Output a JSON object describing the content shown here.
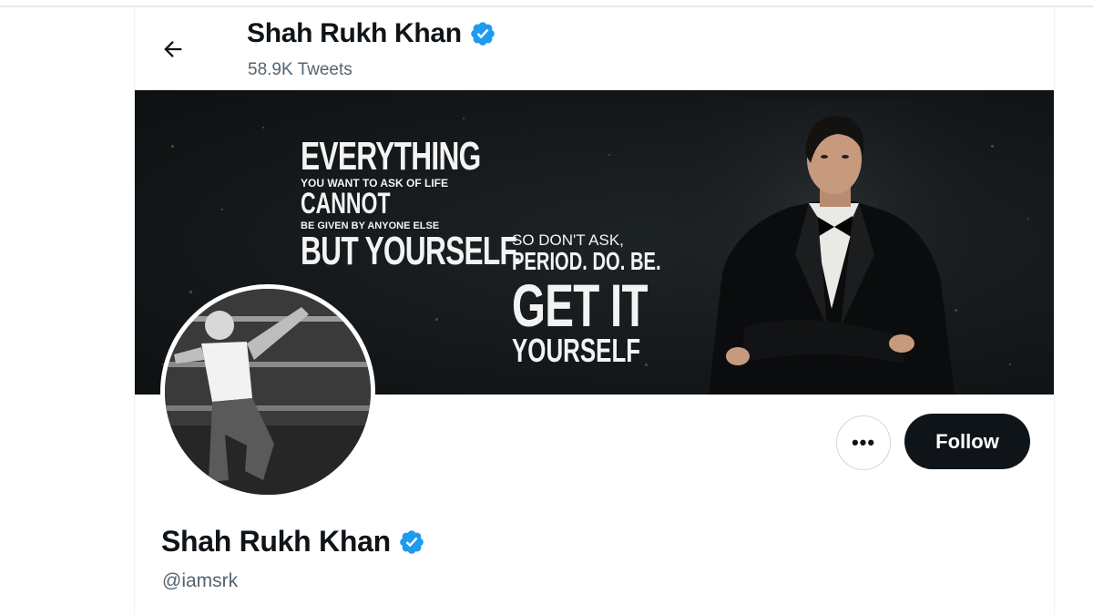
{
  "header": {
    "title": "Shah Rukh Khan",
    "tweet_count": "58.9K Tweets",
    "back_icon": "arrow-left-icon"
  },
  "banner": {
    "line1": "EVERYTHING",
    "line2": "YOU WANT TO ASK OF LIFE",
    "line3": "CANNOT",
    "line4": "BE GIVEN BY ANYONE ELSE",
    "line5": "BUT YOURSELF.",
    "line6": "SO DON'T ASK,",
    "line7": "PERIOD. DO. BE.",
    "line8": "GET IT",
    "line9": "YOURSELF"
  },
  "actions": {
    "more_label": "•••",
    "follow_label": "Follow"
  },
  "profile": {
    "name": "Shah Rukh Khan",
    "handle": "@iamsrk",
    "verified": true
  },
  "colors": {
    "verified_blue": "#1d9bf0",
    "text_primary": "#0f1419",
    "text_secondary": "#536471",
    "follow_bg": "#0f1419"
  }
}
